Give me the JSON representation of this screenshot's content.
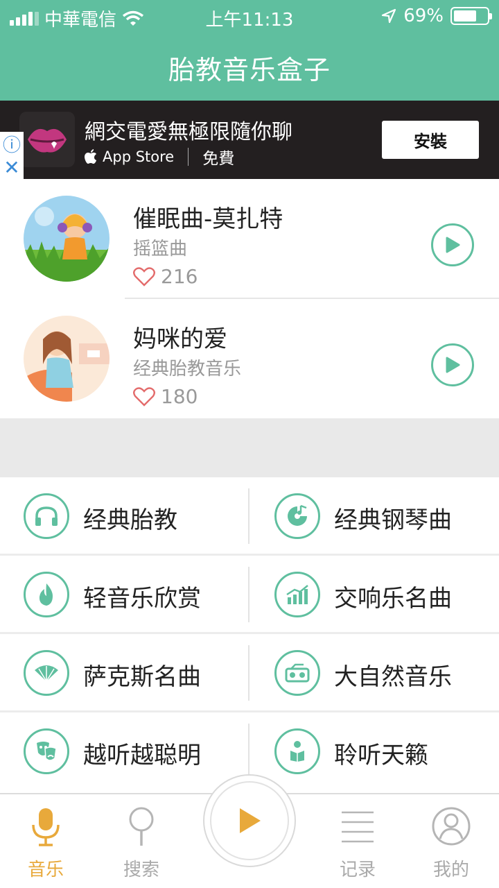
{
  "status": {
    "carrier": "中華電信",
    "time": "上午11:13",
    "battery": "69%",
    "battery_level": 0.69
  },
  "app": {
    "title": "胎教音乐盒子"
  },
  "ad": {
    "title": "網交電愛無極限隨你聊",
    "store": "App Store",
    "price": "免費",
    "install_label": "安裝",
    "info_glyph": "ⓘ",
    "close_glyph": "✕"
  },
  "songs": [
    {
      "title": "催眠曲-莫扎特",
      "subtitle": "摇篮曲",
      "likes": "216"
    },
    {
      "title": "妈咪的爱",
      "subtitle": "经典胎教音乐",
      "likes": "180"
    }
  ],
  "categories": [
    {
      "label": "经典胎教",
      "icon": "headphones-icon"
    },
    {
      "label": "经典钢琴曲",
      "icon": "music-disc-icon"
    },
    {
      "label": "轻音乐欣赏",
      "icon": "flame-icon"
    },
    {
      "label": "交响乐名曲",
      "icon": "bar-chart-icon"
    },
    {
      "label": "萨克斯名曲",
      "icon": "fan-icon"
    },
    {
      "label": "大自然音乐",
      "icon": "radio-icon"
    },
    {
      "label": "越听越聪明",
      "icon": "theater-masks-icon"
    },
    {
      "label": "聆听天籁",
      "icon": "reading-person-icon"
    }
  ],
  "tabs": [
    {
      "label": "音乐",
      "icon": "microphone-icon",
      "active": true
    },
    {
      "label": "搜索",
      "icon": "search-icon",
      "active": false
    },
    {
      "label": "记录",
      "icon": "list-icon",
      "active": false
    },
    {
      "label": "我的",
      "icon": "user-icon",
      "active": false
    }
  ],
  "colors": {
    "accent": "#5fbf9f",
    "active_tab": "#e8a93b",
    "heart": "#e36b6b"
  }
}
